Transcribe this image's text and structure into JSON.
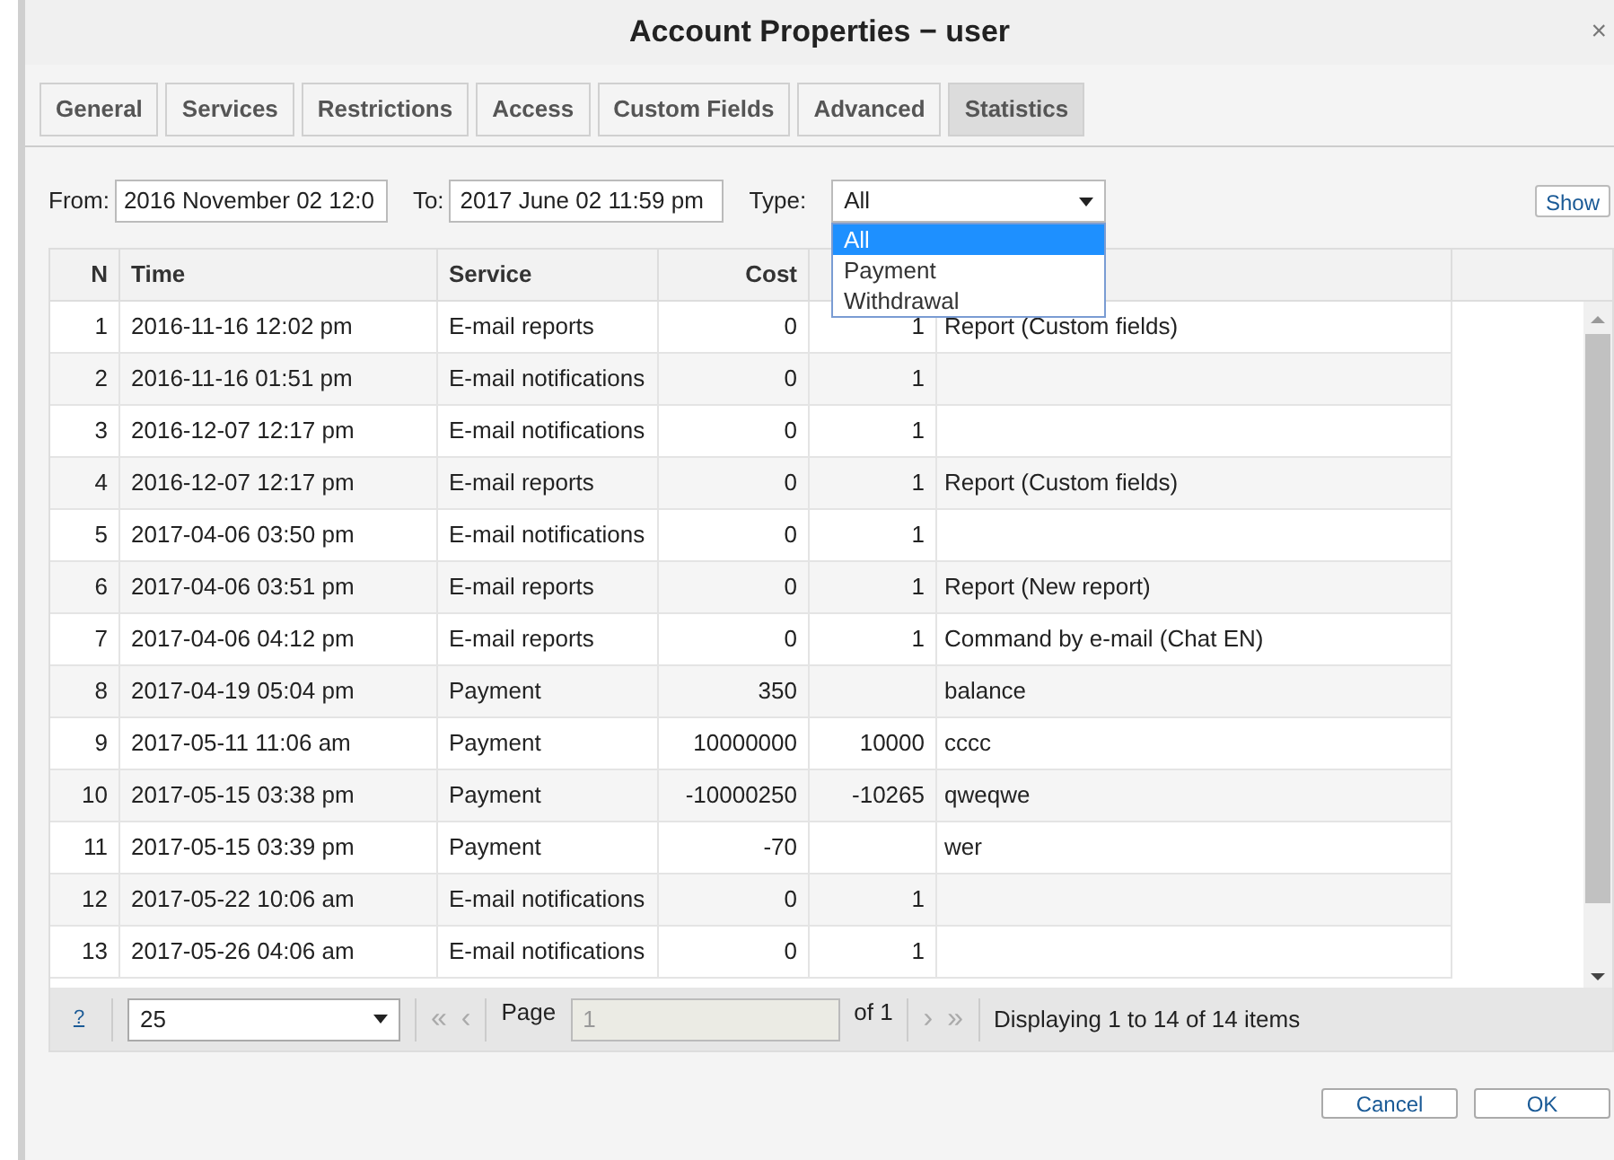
{
  "window": {
    "title": "Account Properties − user",
    "close": "×"
  },
  "tabs": [
    {
      "label": "General",
      "selected": false
    },
    {
      "label": "Services",
      "selected": false
    },
    {
      "label": "Restrictions",
      "selected": false
    },
    {
      "label": "Access",
      "selected": false
    },
    {
      "label": "Custom Fields",
      "selected": false
    },
    {
      "label": "Advanced",
      "selected": false
    },
    {
      "label": "Statistics",
      "selected": true
    }
  ],
  "filters": {
    "from_label": "From:",
    "from_value": "2016 November 02 12:0",
    "to_label": "To:",
    "to_value": "2017 June 02 11:59 pm",
    "type_label": "Type:",
    "type_value": "All",
    "type_options": [
      {
        "label": "All",
        "selected": true
      },
      {
        "label": "Payment",
        "selected": false
      },
      {
        "label": "Withdrawal",
        "selected": false
      }
    ],
    "show_button": "Show"
  },
  "table": {
    "columns": [
      "N",
      "Time",
      "Service",
      "Cost"
    ],
    "rows": [
      {
        "n": "1",
        "time": "2016-11-16 12:02 pm",
        "service": "E-mail reports",
        "cost": "0",
        "column_5": "1",
        "column_6": "Report (Custom fields)"
      },
      {
        "n": "2",
        "time": "2016-11-16 01:51 pm",
        "service": "E-mail notifications",
        "cost": "0",
        "column_5": "1",
        "column_6": ""
      },
      {
        "n": "3",
        "time": "2016-12-07 12:17 pm",
        "service": "E-mail notifications",
        "cost": "0",
        "column_5": "1",
        "column_6": ""
      },
      {
        "n": "4",
        "time": "2016-12-07 12:17 pm",
        "service": "E-mail reports",
        "cost": "0",
        "column_5": "1",
        "column_6": "Report (Custom fields)"
      },
      {
        "n": "5",
        "time": "2017-04-06 03:50 pm",
        "service": "E-mail notifications",
        "cost": "0",
        "column_5": "1",
        "column_6": ""
      },
      {
        "n": "6",
        "time": "2017-04-06 03:51 pm",
        "service": "E-mail reports",
        "cost": "0",
        "column_5": "1",
        "column_6": "Report (New report)"
      },
      {
        "n": "7",
        "time": "2017-04-06 04:12 pm",
        "service": "E-mail reports",
        "cost": "0",
        "column_5": "1",
        "column_6": "Command by e-mail (Chat EN)"
      },
      {
        "n": "8",
        "time": "2017-04-19 05:04 pm",
        "service": "Payment",
        "cost": "350",
        "column_5": "",
        "column_6": "balance"
      },
      {
        "n": "9",
        "time": "2017-05-11 11:06 am",
        "service": "Payment",
        "cost": "10000000",
        "column_5": "10000",
        "column_6": "cccc"
      },
      {
        "n": "10",
        "time": "2017-05-15 03:38 pm",
        "service": "Payment",
        "cost": "-10000250",
        "column_5": "-10265",
        "column_6": "qweqwe"
      },
      {
        "n": "11",
        "time": "2017-05-15 03:39 pm",
        "service": "Payment",
        "cost": "-70",
        "column_5": "",
        "column_6": "wer"
      },
      {
        "n": "12",
        "time": "2017-05-22 10:06 am",
        "service": "E-mail notifications",
        "cost": "0",
        "column_5": "1",
        "column_6": ""
      },
      {
        "n": "13",
        "time": "2017-05-26 04:06 am",
        "service": "E-mail notifications",
        "cost": "0",
        "column_5": "1",
        "column_6": ""
      }
    ]
  },
  "pager": {
    "help": "?",
    "page_size": "25",
    "first": "«",
    "prev": "‹",
    "page_label": "Page",
    "page_value": "1",
    "of_label": "of 1",
    "next": "›",
    "last": "»",
    "info": "Displaying 1 to 14 of 14 items"
  },
  "buttons": [
    "Cancel",
    "OK"
  ]
}
